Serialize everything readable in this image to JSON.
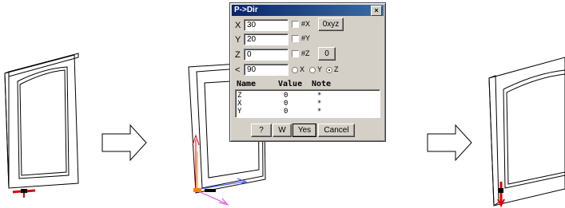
{
  "dialog": {
    "title": "P->Dir",
    "close_label": "×",
    "fields": [
      {
        "label": "X",
        "value": "30",
        "check_label": "#X"
      },
      {
        "label": "Y",
        "value": "20",
        "check_label": "#Y"
      },
      {
        "label": "Z",
        "value": "0",
        "check_label": "#Z"
      },
      {
        "label": "<",
        "value": "90"
      }
    ],
    "oxyz_button": "0xyz",
    "zero_button": "0",
    "radio_options": [
      "X",
      "Y",
      "Z"
    ],
    "radio_selected": "Z",
    "table": {
      "headers": [
        "Name",
        "Value",
        "Note"
      ],
      "rows": [
        [
          "Z",
          "0",
          "*"
        ],
        [
          "X",
          "0",
          "*"
        ],
        [
          "Y",
          "0",
          "*"
        ]
      ]
    },
    "buttons": {
      "help": "?",
      "w": "W",
      "yes": "Yes",
      "cancel": "Cancel"
    }
  },
  "arrows": [
    "arrow-right-icon",
    "arrow-right-icon"
  ],
  "colors": {
    "titlebar": "#0a246a",
    "marker_red": "#e00000",
    "axis_blue": "#3050ff",
    "axis_magenta": "#e040e0",
    "axis_orange": "#ff8000"
  }
}
